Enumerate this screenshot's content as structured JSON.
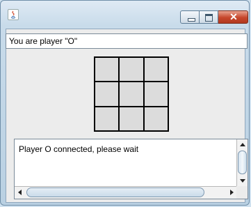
{
  "window": {
    "icon": "java-icon",
    "controls": [
      "minimize-icon",
      "maximize-icon",
      "close-icon"
    ],
    "close_glyph": "✕"
  },
  "status": {
    "text": "You are player \"O\""
  },
  "board": {
    "cells": [
      "",
      "",
      "",
      "",
      "",
      "",
      "",
      "",
      ""
    ]
  },
  "messages": {
    "text": "Player O connected, please wait"
  },
  "colors": {
    "close_button": "#c6462b",
    "frame": "#b9d0e2",
    "client": "#ececec",
    "board_cell": "#dcdcdc"
  }
}
